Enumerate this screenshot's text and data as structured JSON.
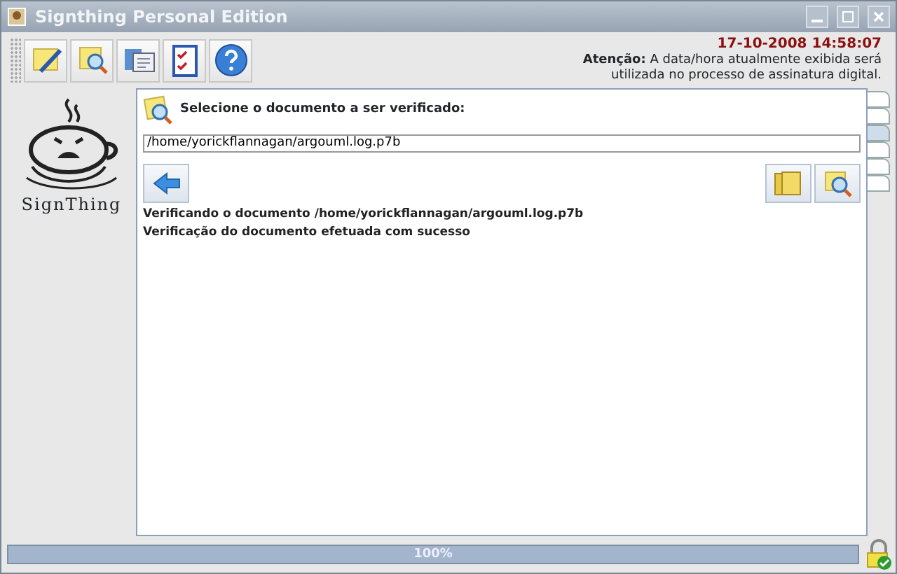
{
  "window": {
    "title": "Signthing Personal Edition"
  },
  "toolbar": {
    "buttons": [
      {
        "kind": "sign"
      },
      {
        "kind": "verify"
      },
      {
        "kind": "certificates"
      },
      {
        "kind": "checklist"
      },
      {
        "kind": "help"
      }
    ]
  },
  "clock": {
    "datetime": "17-10-2008 14:58:07",
    "warning_label": "Atenção:",
    "warning_line_1": "A data/hora atualmente exibida será",
    "warning_line_2": "utilizada no processo de assinatura digital."
  },
  "logo": {
    "text": "SignThing"
  },
  "panel": {
    "heading": "Selecione o documento a ser verificado:",
    "file_path": "/home/yorickflannagan/argouml.log.p7b",
    "messages": [
      "Verificando o documento /home/yorickflannagan/argouml.log.p7b",
      "Verificação do documento efetuada com sucesso"
    ]
  },
  "side_tabs": [
    {
      "selected": false
    },
    {
      "selected": false
    },
    {
      "selected": true
    },
    {
      "selected": false
    },
    {
      "selected": false
    },
    {
      "selected": false
    }
  ],
  "progress": {
    "level": 1,
    "label": "100%"
  }
}
